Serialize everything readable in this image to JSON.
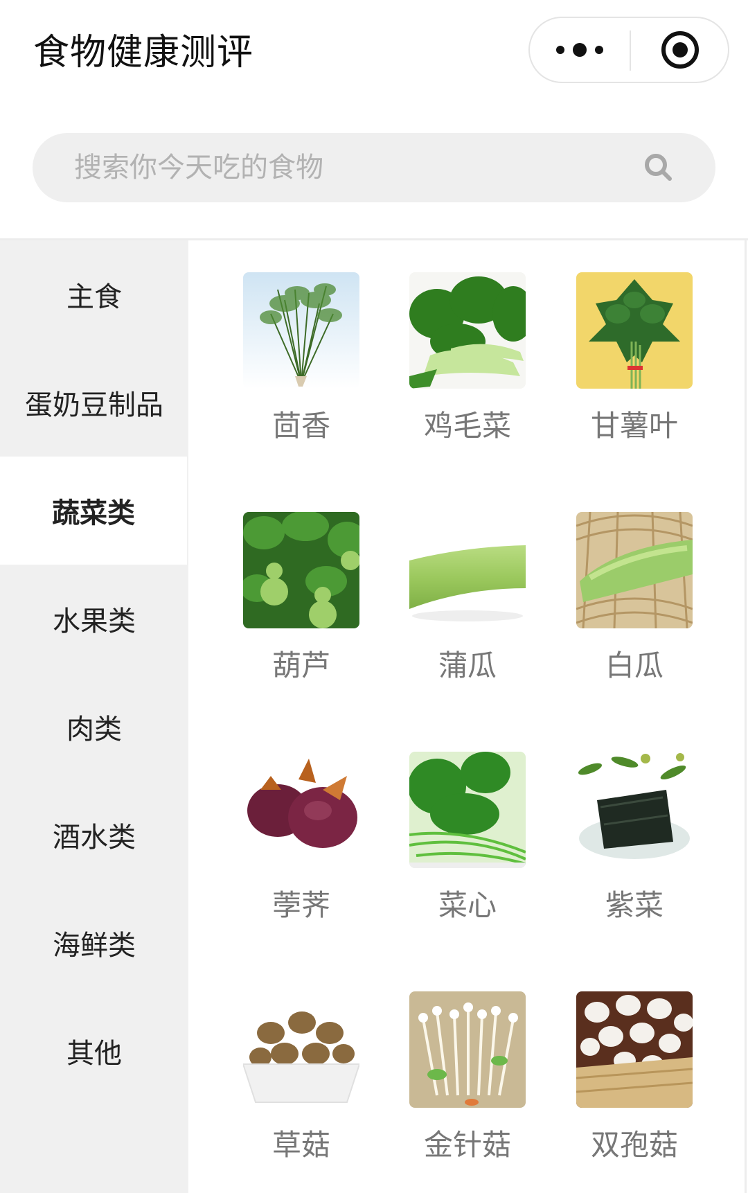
{
  "header": {
    "title": "食物健康测评"
  },
  "search": {
    "placeholder": "搜索你今天吃的食物"
  },
  "sidebar": {
    "items": [
      {
        "label": "主食",
        "active": false
      },
      {
        "label": "蛋奶豆制品",
        "active": false
      },
      {
        "label": "蔬菜类",
        "active": true
      },
      {
        "label": "水果类",
        "active": false
      },
      {
        "label": "肉类",
        "active": false
      },
      {
        "label": "酒水类",
        "active": false
      },
      {
        "label": "海鲜类",
        "active": false
      },
      {
        "label": "其他",
        "active": false
      }
    ]
  },
  "grid": {
    "items": [
      {
        "label": "茴香"
      },
      {
        "label": "鸡毛菜"
      },
      {
        "label": "甘薯叶"
      },
      {
        "label": "葫芦"
      },
      {
        "label": "蒲瓜"
      },
      {
        "label": "白瓜"
      },
      {
        "label": "荸荠"
      },
      {
        "label": "菜心"
      },
      {
        "label": "紫菜"
      },
      {
        "label": "草菇"
      },
      {
        "label": "金针菇"
      },
      {
        "label": "双孢菇"
      }
    ]
  }
}
